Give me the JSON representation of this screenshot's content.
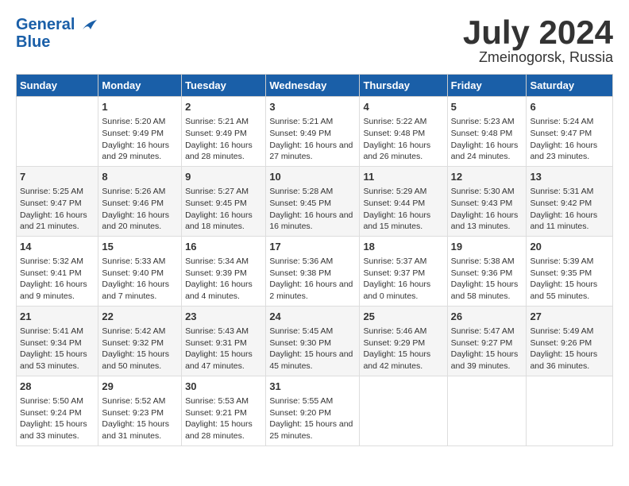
{
  "header": {
    "logo_line1": "General",
    "logo_line2": "Blue",
    "month": "July 2024",
    "location": "Zmeinogorsk, Russia"
  },
  "days_of_week": [
    "Sunday",
    "Monday",
    "Tuesday",
    "Wednesday",
    "Thursday",
    "Friday",
    "Saturday"
  ],
  "weeks": [
    [
      {
        "day": "",
        "sunrise": "",
        "sunset": "",
        "daylight": ""
      },
      {
        "day": "1",
        "sunrise": "Sunrise: 5:20 AM",
        "sunset": "Sunset: 9:49 PM",
        "daylight": "Daylight: 16 hours and 29 minutes."
      },
      {
        "day": "2",
        "sunrise": "Sunrise: 5:21 AM",
        "sunset": "Sunset: 9:49 PM",
        "daylight": "Daylight: 16 hours and 28 minutes."
      },
      {
        "day": "3",
        "sunrise": "Sunrise: 5:21 AM",
        "sunset": "Sunset: 9:49 PM",
        "daylight": "Daylight: 16 hours and 27 minutes."
      },
      {
        "day": "4",
        "sunrise": "Sunrise: 5:22 AM",
        "sunset": "Sunset: 9:48 PM",
        "daylight": "Daylight: 16 hours and 26 minutes."
      },
      {
        "day": "5",
        "sunrise": "Sunrise: 5:23 AM",
        "sunset": "Sunset: 9:48 PM",
        "daylight": "Daylight: 16 hours and 24 minutes."
      },
      {
        "day": "6",
        "sunrise": "Sunrise: 5:24 AM",
        "sunset": "Sunset: 9:47 PM",
        "daylight": "Daylight: 16 hours and 23 minutes."
      }
    ],
    [
      {
        "day": "7",
        "sunrise": "Sunrise: 5:25 AM",
        "sunset": "Sunset: 9:47 PM",
        "daylight": "Daylight: 16 hours and 21 minutes."
      },
      {
        "day": "8",
        "sunrise": "Sunrise: 5:26 AM",
        "sunset": "Sunset: 9:46 PM",
        "daylight": "Daylight: 16 hours and 20 minutes."
      },
      {
        "day": "9",
        "sunrise": "Sunrise: 5:27 AM",
        "sunset": "Sunset: 9:45 PM",
        "daylight": "Daylight: 16 hours and 18 minutes."
      },
      {
        "day": "10",
        "sunrise": "Sunrise: 5:28 AM",
        "sunset": "Sunset: 9:45 PM",
        "daylight": "Daylight: 16 hours and 16 minutes."
      },
      {
        "day": "11",
        "sunrise": "Sunrise: 5:29 AM",
        "sunset": "Sunset: 9:44 PM",
        "daylight": "Daylight: 16 hours and 15 minutes."
      },
      {
        "day": "12",
        "sunrise": "Sunrise: 5:30 AM",
        "sunset": "Sunset: 9:43 PM",
        "daylight": "Daylight: 16 hours and 13 minutes."
      },
      {
        "day": "13",
        "sunrise": "Sunrise: 5:31 AM",
        "sunset": "Sunset: 9:42 PM",
        "daylight": "Daylight: 16 hours and 11 minutes."
      }
    ],
    [
      {
        "day": "14",
        "sunrise": "Sunrise: 5:32 AM",
        "sunset": "Sunset: 9:41 PM",
        "daylight": "Daylight: 16 hours and 9 minutes."
      },
      {
        "day": "15",
        "sunrise": "Sunrise: 5:33 AM",
        "sunset": "Sunset: 9:40 PM",
        "daylight": "Daylight: 16 hours and 7 minutes."
      },
      {
        "day": "16",
        "sunrise": "Sunrise: 5:34 AM",
        "sunset": "Sunset: 9:39 PM",
        "daylight": "Daylight: 16 hours and 4 minutes."
      },
      {
        "day": "17",
        "sunrise": "Sunrise: 5:36 AM",
        "sunset": "Sunset: 9:38 PM",
        "daylight": "Daylight: 16 hours and 2 minutes."
      },
      {
        "day": "18",
        "sunrise": "Sunrise: 5:37 AM",
        "sunset": "Sunset: 9:37 PM",
        "daylight": "Daylight: 16 hours and 0 minutes."
      },
      {
        "day": "19",
        "sunrise": "Sunrise: 5:38 AM",
        "sunset": "Sunset: 9:36 PM",
        "daylight": "Daylight: 15 hours and 58 minutes."
      },
      {
        "day": "20",
        "sunrise": "Sunrise: 5:39 AM",
        "sunset": "Sunset: 9:35 PM",
        "daylight": "Daylight: 15 hours and 55 minutes."
      }
    ],
    [
      {
        "day": "21",
        "sunrise": "Sunrise: 5:41 AM",
        "sunset": "Sunset: 9:34 PM",
        "daylight": "Daylight: 15 hours and 53 minutes."
      },
      {
        "day": "22",
        "sunrise": "Sunrise: 5:42 AM",
        "sunset": "Sunset: 9:32 PM",
        "daylight": "Daylight: 15 hours and 50 minutes."
      },
      {
        "day": "23",
        "sunrise": "Sunrise: 5:43 AM",
        "sunset": "Sunset: 9:31 PM",
        "daylight": "Daylight: 15 hours and 47 minutes."
      },
      {
        "day": "24",
        "sunrise": "Sunrise: 5:45 AM",
        "sunset": "Sunset: 9:30 PM",
        "daylight": "Daylight: 15 hours and 45 minutes."
      },
      {
        "day": "25",
        "sunrise": "Sunrise: 5:46 AM",
        "sunset": "Sunset: 9:29 PM",
        "daylight": "Daylight: 15 hours and 42 minutes."
      },
      {
        "day": "26",
        "sunrise": "Sunrise: 5:47 AM",
        "sunset": "Sunset: 9:27 PM",
        "daylight": "Daylight: 15 hours and 39 minutes."
      },
      {
        "day": "27",
        "sunrise": "Sunrise: 5:49 AM",
        "sunset": "Sunset: 9:26 PM",
        "daylight": "Daylight: 15 hours and 36 minutes."
      }
    ],
    [
      {
        "day": "28",
        "sunrise": "Sunrise: 5:50 AM",
        "sunset": "Sunset: 9:24 PM",
        "daylight": "Daylight: 15 hours and 33 minutes."
      },
      {
        "day": "29",
        "sunrise": "Sunrise: 5:52 AM",
        "sunset": "Sunset: 9:23 PM",
        "daylight": "Daylight: 15 hours and 31 minutes."
      },
      {
        "day": "30",
        "sunrise": "Sunrise: 5:53 AM",
        "sunset": "Sunset: 9:21 PM",
        "daylight": "Daylight: 15 hours and 28 minutes."
      },
      {
        "day": "31",
        "sunrise": "Sunrise: 5:55 AM",
        "sunset": "Sunset: 9:20 PM",
        "daylight": "Daylight: 15 hours and 25 minutes."
      },
      {
        "day": "",
        "sunrise": "",
        "sunset": "",
        "daylight": ""
      },
      {
        "day": "",
        "sunrise": "",
        "sunset": "",
        "daylight": ""
      },
      {
        "day": "",
        "sunrise": "",
        "sunset": "",
        "daylight": ""
      }
    ]
  ]
}
